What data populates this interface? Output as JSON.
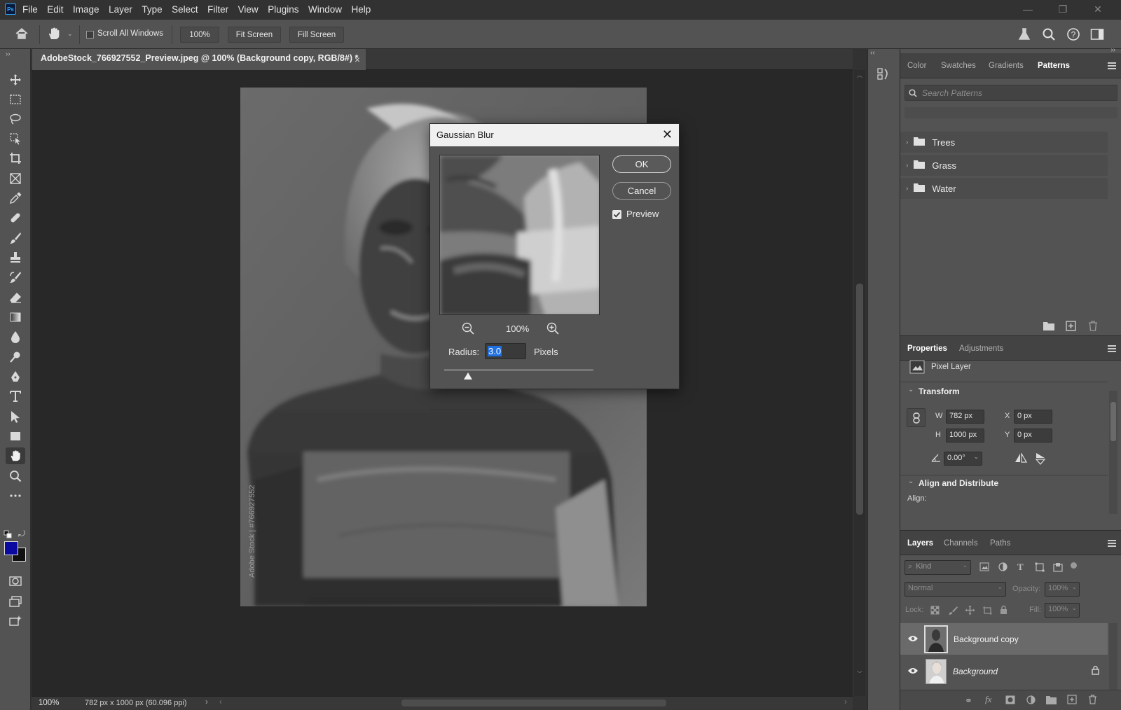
{
  "app": {
    "logo_text": "Ps"
  },
  "menu": [
    "File",
    "Edit",
    "Image",
    "Layer",
    "Type",
    "Select",
    "Filter",
    "View",
    "Plugins",
    "Window",
    "Help"
  ],
  "window_controls": {
    "minimize": "—",
    "restore": "❐",
    "close": "✕"
  },
  "options_bar": {
    "scroll_all_windows": "Scroll All Windows",
    "scroll_all_checked": false,
    "zoom_button": "100%",
    "fit_screen": "Fit Screen",
    "fill_screen": "Fill Screen"
  },
  "document": {
    "tab_title": "AdobeStock_766927552_Preview.jpeg @ 100% (Background copy, RGB/8#) *",
    "tab_close": "×",
    "watermark": "Adobe Stock | #766927552"
  },
  "status_bar": {
    "zoom": "100%",
    "doc_info": "782 px x 1000 px (60.096 ppi)",
    "arrow": "›",
    "scroll_arrow_left": "‹",
    "scroll_arrow_right": "›"
  },
  "colors": {
    "foreground": "#0a0aa0",
    "background": "#111111",
    "accent_blue": "#31a8ff"
  },
  "patterns_panel": {
    "tabs": [
      "Color",
      "Swatches",
      "Gradients",
      "Patterns"
    ],
    "active_tab": "Patterns",
    "search_placeholder": "Search Patterns",
    "folders": [
      "Trees",
      "Grass",
      "Water"
    ]
  },
  "properties_panel": {
    "tabs": [
      "Properties",
      "Adjustments"
    ],
    "active_tab": "Properties",
    "layer_type": "Pixel Layer",
    "transform_header": "Transform",
    "w_label": "W",
    "w_value": "782 px",
    "h_label": "H",
    "h_value": "1000 px",
    "x_label": "X",
    "x_value": "0 px",
    "y_label": "Y",
    "y_value": "0 px",
    "angle_value": "0.00°",
    "align_header": "Align and Distribute",
    "align_label": "Align:"
  },
  "layers_panel": {
    "tabs": [
      "Layers",
      "Channels",
      "Paths"
    ],
    "active_tab": "Layers",
    "kind_placeholder": "Kind",
    "blend_mode": "Normal",
    "opacity_label": "Opacity:",
    "opacity_value": "100%",
    "lock_label": "Lock:",
    "fill_label": "Fill:",
    "fill_value": "100%",
    "layers": [
      {
        "name": "Background copy",
        "selected": true,
        "locked": false
      },
      {
        "name": "Background",
        "selected": false,
        "locked": true
      }
    ]
  },
  "gaussian_blur": {
    "title": "Gaussian Blur",
    "ok": "OK",
    "cancel": "Cancel",
    "preview_label": "Preview",
    "preview_checked": true,
    "zoom_level": "100%",
    "radius_label": "Radius:",
    "radius_value": "3.0",
    "units": "Pixels",
    "radius_slider_fraction": 0.16
  }
}
